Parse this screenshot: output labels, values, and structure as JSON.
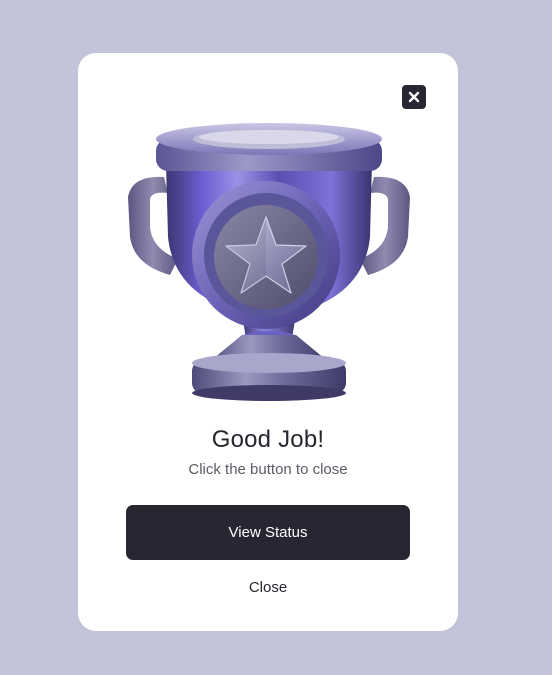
{
  "colors": {
    "backdrop": "#c3c3d9",
    "card": "#ffffff",
    "dark": "#272733",
    "title": "#26262e",
    "subtitle": "#5c5c66",
    "button_text": "#ffffff",
    "trophy_purple": "#6b5bc9",
    "trophy_metal": "#8b8aa6"
  },
  "icons": {
    "close": "close-icon",
    "trophy": "trophy-icon",
    "star": "star-icon"
  },
  "modal": {
    "title": "Good Job!",
    "subtitle": "Click the button to close",
    "primary_button_label": "View Status",
    "close_link_label": "Close"
  }
}
